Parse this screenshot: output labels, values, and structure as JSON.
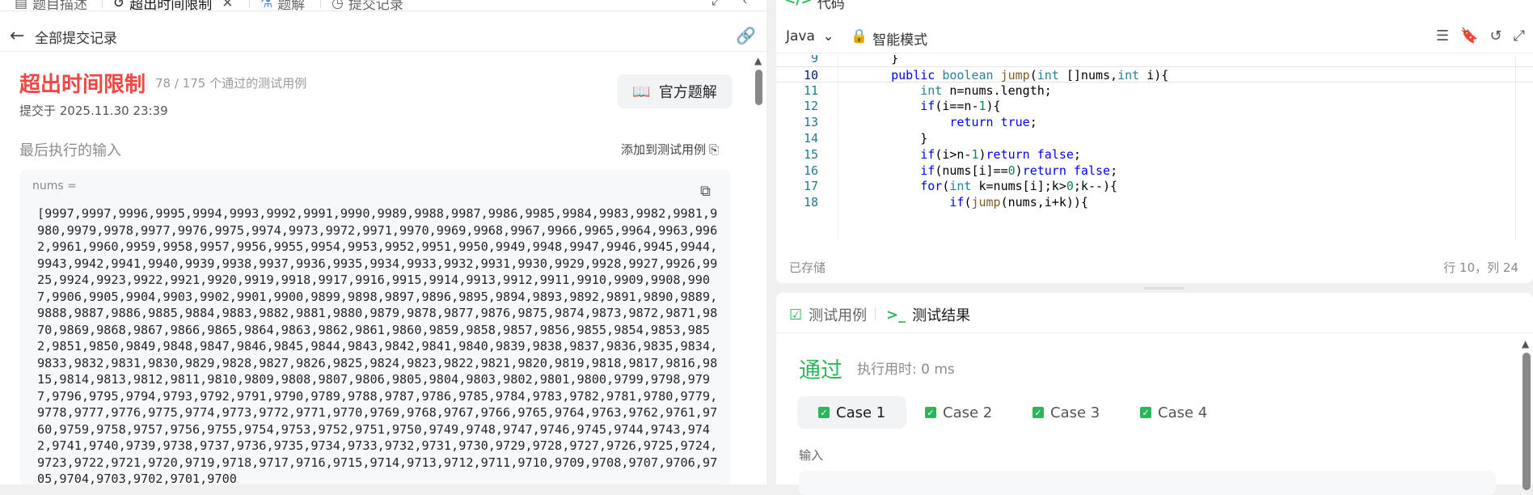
{
  "left_tabs": [
    {
      "label": "题目描述",
      "icon": "document-icon"
    },
    {
      "label": "超出时间限制",
      "icon": "history-icon",
      "active": true
    },
    {
      "label": "题解",
      "icon": "flask-icon"
    },
    {
      "label": "提交记录",
      "icon": "clock-icon"
    }
  ],
  "back_bar": {
    "label": "全部提交记录"
  },
  "submission": {
    "status": "超出时间限制",
    "passed": "78 / 175 个通过的测试用例",
    "submitted_at": "提交于 2025.11.30 23:39",
    "official_solution": "官方题解",
    "last_input_label": "最后执行的输入",
    "add_test_case": "添加到测试用例",
    "var_name": "nums =",
    "nums_text": "[9997,9997,9996,9995,9994,9993,9992,9991,9990,9989,9988,9987,9986,9985,9984,9983,9982,9981,9980,9979,9978,9977,9976,9975,9974,9973,9972,9971,9970,9969,9968,9967,9966,9965,9964,9963,9962,9961,9960,9959,9958,9957,9956,9955,9954,9953,9952,9951,9950,9949,9948,9947,9946,9945,9944,9943,9942,9941,9940,9939,9938,9937,9936,9935,9934,9933,9932,9931,9930,9929,9928,9927,9926,9925,9924,9923,9922,9921,9920,9919,9918,9917,9916,9915,9914,9913,9912,9911,9910,9909,9908,9907,9906,9905,9904,9903,9902,9901,9900,9899,9898,9897,9896,9895,9894,9893,9892,9891,9890,9889,9888,9887,9886,9885,9884,9883,9882,9881,9880,9879,9878,9877,9876,9875,9874,9873,9872,9871,9870,9869,9868,9867,9866,9865,9864,9863,9862,9861,9860,9859,9858,9857,9856,9855,9854,9853,9852,9851,9850,9849,9848,9847,9846,9845,9844,9843,9842,9841,9840,9839,9838,9837,9836,9835,9834,9833,9832,9831,9830,9829,9828,9827,9826,9825,9824,9823,9822,9821,9820,9819,9818,9817,9816,9815,9814,9813,9812,9811,9810,9809,9808,9807,9806,9805,9804,9803,9802,9801,9800,9799,9798,9797,9796,9795,9794,9793,9792,9791,9790,9789,9788,9787,9786,9785,9784,9783,9782,9781,9780,9779,9778,9777,9776,9775,9774,9773,9772,9771,9770,9769,9768,9767,9766,9765,9764,9763,9762,9761,9760,9759,9758,9757,9756,9755,9754,9753,9752,9751,9750,9749,9748,9747,9746,9745,9744,9743,9742,9741,9740,9739,9738,9737,9736,9735,9734,9733,9732,9731,9730,9729,9728,9727,9726,9725,9724,9723,9722,9721,9720,9719,9718,9717,9716,9715,9714,9713,9712,9711,9710,9709,9708,9707,9706,9705,9704,9703,9702,9701,9700"
  },
  "editor": {
    "title": "代码",
    "language": "Java",
    "mode": "智能模式",
    "saved": "已存储",
    "cursor": "行 10，列 24",
    "lines": [
      {
        "n": "9",
        "code": "    }"
      },
      {
        "n": "10",
        "code": "    public boolean jump(int []nums,int i){"
      },
      {
        "n": "11",
        "code": "        int n=nums.length;"
      },
      {
        "n": "12",
        "code": "        if(i==n-1){"
      },
      {
        "n": "13",
        "code": "            return true;"
      },
      {
        "n": "14",
        "code": "        }"
      },
      {
        "n": "15",
        "code": "        if(i>n-1)return false;"
      },
      {
        "n": "16",
        "code": "        if(nums[i]==0)return false;"
      },
      {
        "n": "17",
        "code": "        for(int k=nums[i];k>0;k--){"
      },
      {
        "n": "18",
        "code": "            if(jump(nums,i+k)){"
      }
    ]
  },
  "results": {
    "tab_testcase": "测试用例",
    "tab_result": "测试结果",
    "status": "通过",
    "exec_time": "执行用时: 0 ms",
    "cases": [
      "Case 1",
      "Case 2",
      "Case 3",
      "Case 4"
    ],
    "input_label": "输入"
  }
}
